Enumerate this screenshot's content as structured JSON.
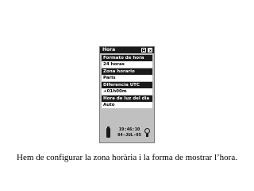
{
  "window": {
    "title": "Hora"
  },
  "settings": [
    {
      "label": "Formato de hora",
      "value": "24 horas"
    },
    {
      "label": "Zona horario",
      "value": "Paris"
    },
    {
      "label": "Diferencia UTC",
      "value": "+01h00m"
    },
    {
      "label": "Hora de luz del dia",
      "value": "Auto"
    }
  ],
  "status": {
    "time": "19:46:10",
    "date": "04-JUL-05"
  },
  "icons": {
    "menu": "menu-icon",
    "close": "close-icon",
    "battery": "battery-icon",
    "backlight": "lightbulb-icon"
  },
  "caption": "Hem de configurar la zona horària i la forma de mostrar l’hora."
}
